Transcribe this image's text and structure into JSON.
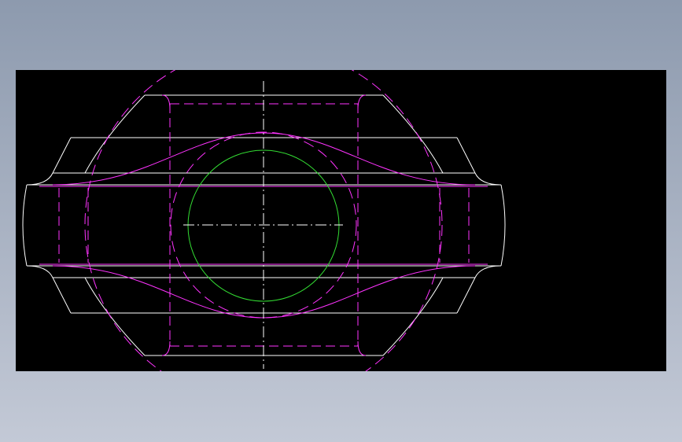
{
  "app": {
    "background_top": "#8d9aae",
    "background_bottom": "#c3c9d6"
  },
  "viewport": {
    "background": "#000000"
  },
  "drawing": {
    "line_colors": {
      "outline": "#ffffff",
      "hidden": "#ff33ff",
      "circle": "#33dd33",
      "centerline": "#ffffff"
    },
    "line_types": [
      "continuous",
      "dashed",
      "dash-dot"
    ],
    "shapes": [
      "body-outline",
      "end-flanges",
      "bore-circle",
      "center-axes",
      "hidden-ball-profile"
    ]
  }
}
